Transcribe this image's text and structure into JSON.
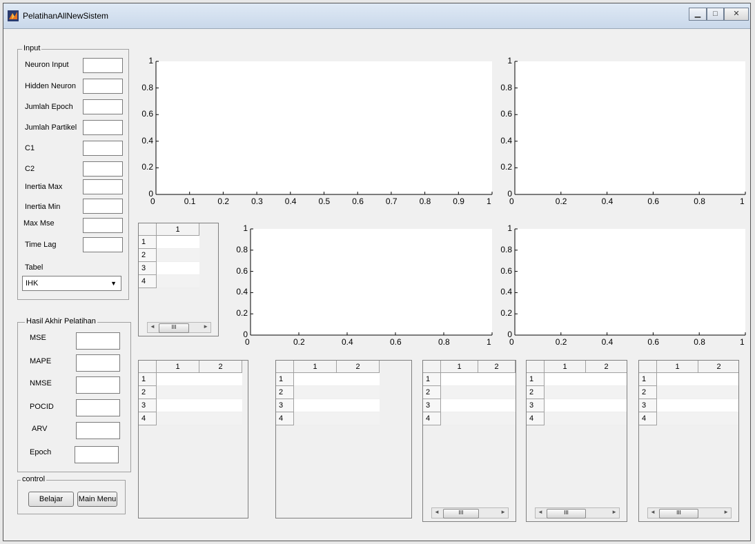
{
  "window": {
    "title": "PelatihanAllNewSistem",
    "controls": {
      "minimize": "▁",
      "maximize": "□",
      "close": "✕"
    }
  },
  "input_panel": {
    "title": "Input",
    "fields": [
      {
        "label": "Neuron Input",
        "value": ""
      },
      {
        "label": "Hidden Neuron",
        "value": ""
      },
      {
        "label": "Jumlah Epoch",
        "value": ""
      },
      {
        "label": "Jumlah Partikel",
        "value": ""
      },
      {
        "label": "C1",
        "value": ""
      },
      {
        "label": "C2",
        "value": ""
      },
      {
        "label": "Inertia Max",
        "value": ""
      },
      {
        "label": "Inertia Min",
        "value": ""
      },
      {
        "label": "Max Mse",
        "value": ""
      },
      {
        "label": "Time Lag",
        "value": ""
      }
    ],
    "table_label": "Tabel",
    "table_select": "IHK"
  },
  "result_panel": {
    "title": "Hasil Akhir Pelatihan",
    "fields": [
      {
        "label": "MSE",
        "value": ""
      },
      {
        "label": "MAPE",
        "value": ""
      },
      {
        "label": "NMSE",
        "value": ""
      },
      {
        "label": "POCID",
        "value": ""
      },
      {
        "label": "ARV",
        "value": ""
      },
      {
        "label": "Epoch",
        "value": ""
      }
    ]
  },
  "control_panel": {
    "title": "control",
    "learn_button": "Belajar",
    "menu_button": "Main Menu"
  },
  "axes": {
    "y_ticks": [
      "1",
      "0.8",
      "0.6",
      "0.4",
      "0.2",
      "0"
    ],
    "x_ticks_decimal": [
      "0",
      "0.1",
      "0.2",
      "0.3",
      "0.4",
      "0.5",
      "0.6",
      "0.7",
      "0.8",
      "0.9",
      "1"
    ],
    "x_ticks_fifth": [
      "0",
      "0.2",
      "0.4",
      "0.6",
      "0.8",
      "1"
    ]
  },
  "tables": {
    "row_labels": [
      "1",
      "2",
      "3",
      "4"
    ],
    "one_col": [
      "1"
    ],
    "two_col": [
      "1",
      "2"
    ],
    "scroll_thumb": "III"
  }
}
